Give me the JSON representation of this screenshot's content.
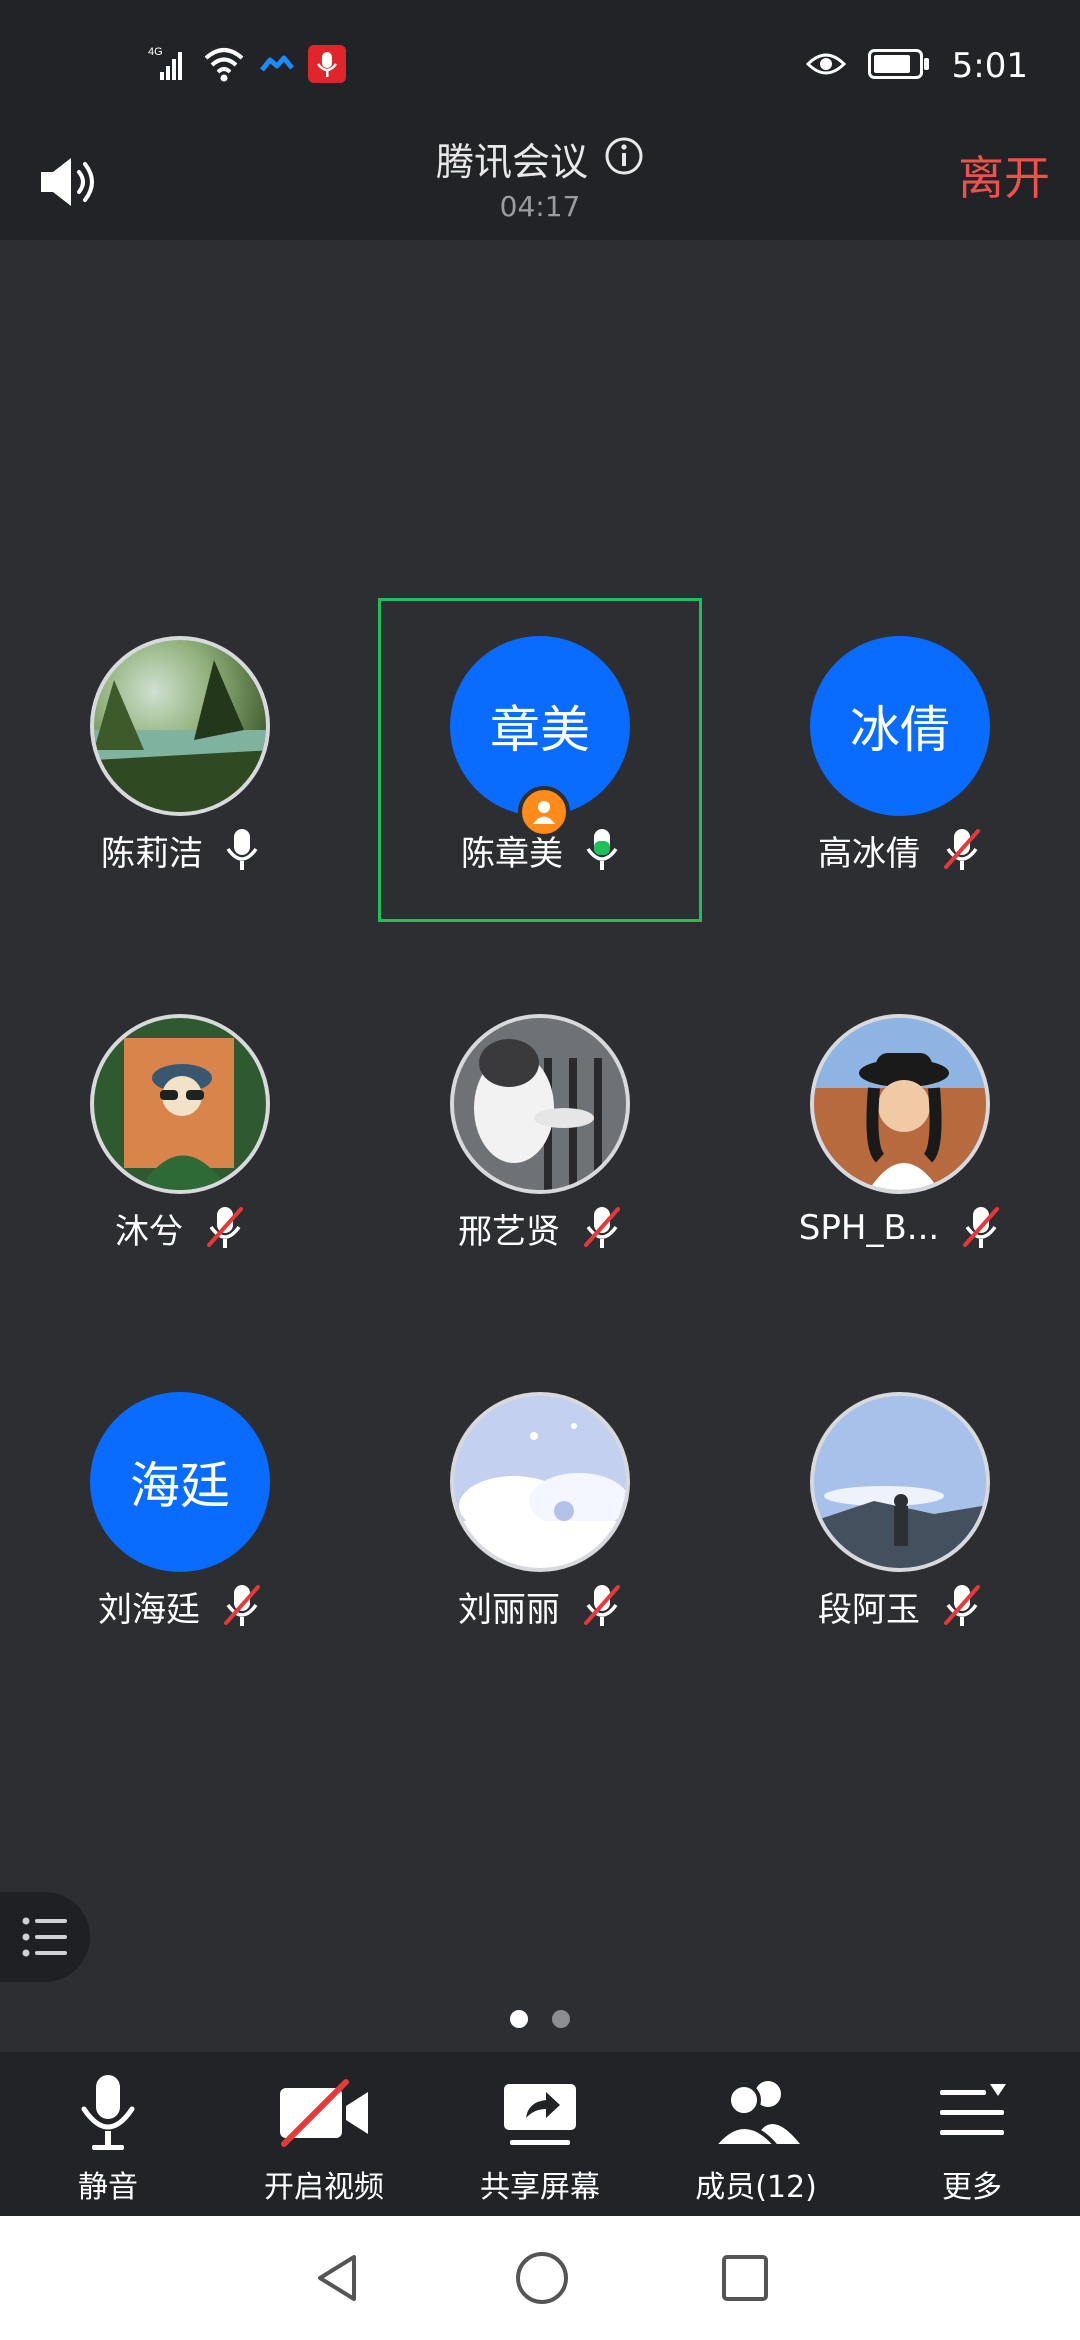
{
  "status_bar": {
    "network": "4G",
    "time": "5:01"
  },
  "header": {
    "title": "腾讯会议",
    "timer": "04:17",
    "leave_label": "离开"
  },
  "participants": [
    {
      "name": "陈莉洁",
      "avatar_type": "photo",
      "avatar_text": "",
      "mic": "on",
      "photo_colors": [
        "#3e5a2c",
        "#8fb07a",
        "#cfe0d0"
      ]
    },
    {
      "name": "陈章美",
      "avatar_type": "initials",
      "avatar_text": "章美",
      "mic": "speaking",
      "host": true
    },
    {
      "name": "高冰倩",
      "avatar_type": "initials",
      "avatar_text": "冰倩",
      "mic": "muted"
    },
    {
      "name": "沐兮",
      "avatar_type": "photo",
      "avatar_text": "",
      "mic": "muted",
      "photo_colors": [
        "#2f5a30",
        "#d9844a",
        "#1c2320"
      ]
    },
    {
      "name": "邢艺贤",
      "avatar_type": "photo",
      "avatar_text": "",
      "mic": "muted",
      "photo_colors": [
        "#8a8d93",
        "#f2f2f2",
        "#2a2a2d"
      ]
    },
    {
      "name": "SPH_B...",
      "avatar_type": "photo",
      "avatar_text": "",
      "mic": "muted",
      "photo_colors": [
        "#7fa7d8",
        "#b76a3e",
        "#1a1a1a"
      ]
    },
    {
      "name": "刘海廷",
      "avatar_type": "initials",
      "avatar_text": "海廷",
      "mic": "muted"
    },
    {
      "name": "刘丽丽",
      "avatar_type": "photo",
      "avatar_text": "",
      "mic": "muted",
      "photo_colors": [
        "#c9d4f2",
        "#ffffff",
        "#b4c2ea"
      ]
    },
    {
      "name": "段阿玉",
      "avatar_type": "photo",
      "avatar_text": "",
      "mic": "muted",
      "photo_colors": [
        "#9cb8e6",
        "#e8eef8",
        "#45505e"
      ]
    }
  ],
  "pager": {
    "pages": 2,
    "current": 1
  },
  "toolbar": {
    "mute_label": "静音",
    "video_label": "开启视频",
    "share_label": "共享屏幕",
    "members_label": "成员(12)",
    "more_label": "更多"
  },
  "colors": {
    "accent_blue": "#0a6cff",
    "leave_red": "#f0514c",
    "speaking_green": "#1fbf5c",
    "muted_red": "#e5393a",
    "host_orange": "#ff8c1a"
  }
}
